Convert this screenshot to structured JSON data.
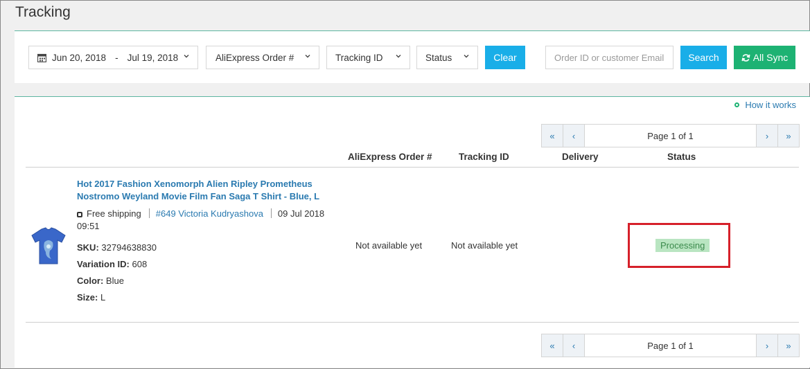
{
  "page": {
    "title": "Tracking"
  },
  "filters": {
    "date_start": "Jun 20, 2018",
    "date_sep": "-",
    "date_end": "Jul 19, 2018",
    "order_select": "AliExpress Order #",
    "tracking_select": "Tracking ID",
    "status_select": "Status",
    "clear_label": "Clear",
    "search_placeholder": "Order ID or customer Email",
    "search_label": "Search",
    "sync_label": "All Sync"
  },
  "results": {
    "how_link": "How it works",
    "pager_info": "Page 1 of 1",
    "pager_first": "«",
    "pager_prev": "‹",
    "pager_next": "›",
    "pager_last": "»",
    "columns": [
      "AliExpress Order #",
      "Tracking ID",
      "Delivery",
      "Status"
    ],
    "row": {
      "title_line1": "Hot 2017 Fashion Xenomorph Alien Ripley Prometheus",
      "title_line2": "Nostromo Weyland Movie Film Fan Saga T Shirt - Blue, L",
      "shipping": "Free shipping",
      "customer": "#649 Victoria Kudryashova",
      "date": "09 Jul 2018",
      "time": "09:51",
      "sku_label": "SKU:",
      "sku": "32794638830",
      "variation_label": "Variation ID:",
      "variation": "608",
      "color_label": "Color:",
      "color": "Blue",
      "size_label": "Size:",
      "size": "L",
      "order_number": "Not available yet",
      "tracking_id": "Not available yet",
      "status": "Processing"
    }
  },
  "colors": {
    "accent_blue": "#19aee8",
    "sync_green": "#1db273",
    "link_blue": "#2a7ab0",
    "status_bg": "#b9e5c1",
    "highlight_red": "#d6202a"
  }
}
